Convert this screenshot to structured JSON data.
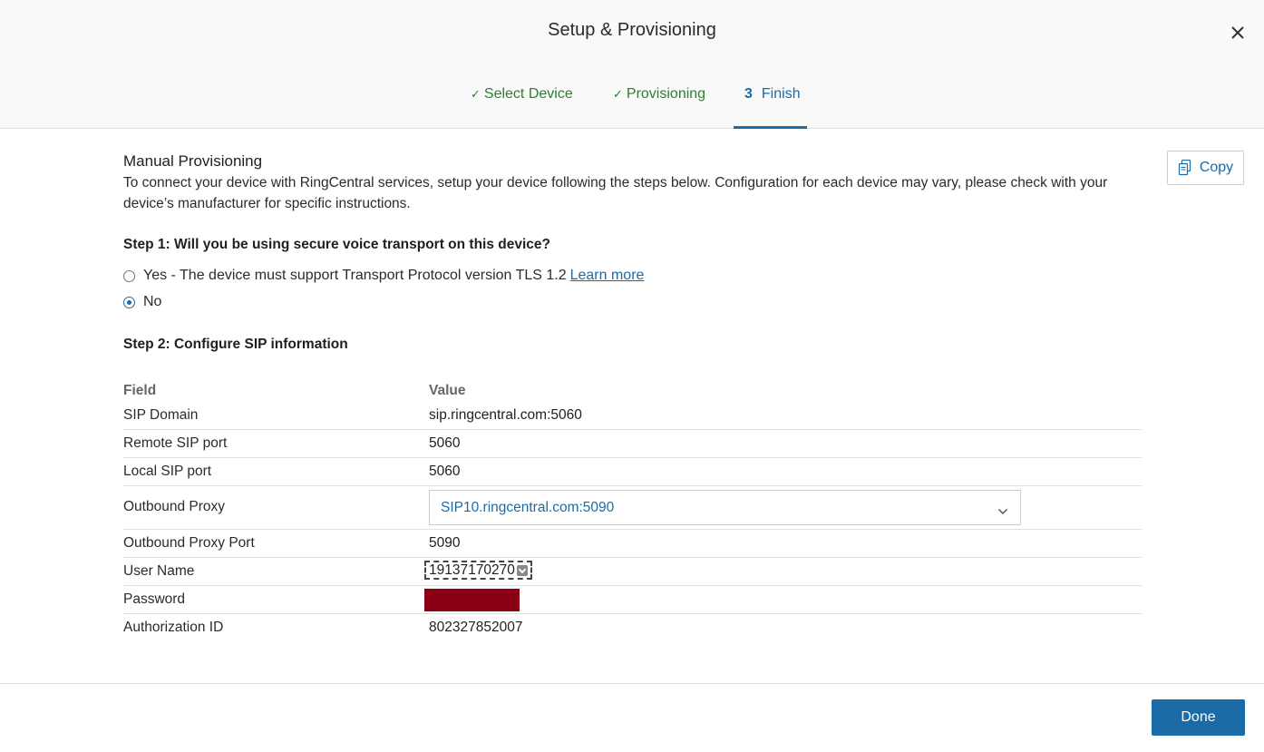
{
  "header": {
    "title": "Setup & Provisioning",
    "steps": [
      {
        "check": "✓",
        "label": "Select Device",
        "state": "completed"
      },
      {
        "check": "✓",
        "label": "Provisioning",
        "state": "completed"
      },
      {
        "number": "3",
        "label": "Finish",
        "state": "active"
      }
    ]
  },
  "manual": {
    "title": "Manual Provisioning",
    "description": "To connect your device with RingCentral services, setup your device following the steps below. Configuration for each device may vary, please check with your device’s manufacturer for specific instructions.",
    "copy_label": "Copy"
  },
  "step1": {
    "heading": "Step 1: Will you be using secure voice transport on this device?",
    "options": [
      {
        "label": "Yes - The device must support Transport Protocol version TLS 1.2",
        "link": "Learn more",
        "selected": false
      },
      {
        "label": "No",
        "selected": true
      }
    ]
  },
  "step2": {
    "heading": "Step 2: Configure SIP information",
    "columns": {
      "field": "Field",
      "value": "Value"
    },
    "rows": [
      {
        "field": "SIP Domain",
        "value": "sip.ringcentral.com:5060"
      },
      {
        "field": "Remote SIP port",
        "value": "5060"
      },
      {
        "field": "Local SIP port",
        "value": "5060"
      },
      {
        "field": "Outbound Proxy",
        "value": "SIP10.ringcentral.com:5090"
      },
      {
        "field": "Outbound Proxy Port",
        "value": "5090"
      },
      {
        "field": "User Name",
        "value": "19137170270"
      },
      {
        "field": "Password",
        "value": ""
      },
      {
        "field": "Authorization ID",
        "value": "802327852007"
      }
    ]
  },
  "footer": {
    "done_label": "Done"
  },
  "colors": {
    "accent": "#1a6ba6",
    "completed": "#2e7d32",
    "redaction": "#8b0015"
  },
  "icons": [
    "close-icon",
    "copy-icon",
    "chevron-down-icon",
    "check-icon"
  ]
}
